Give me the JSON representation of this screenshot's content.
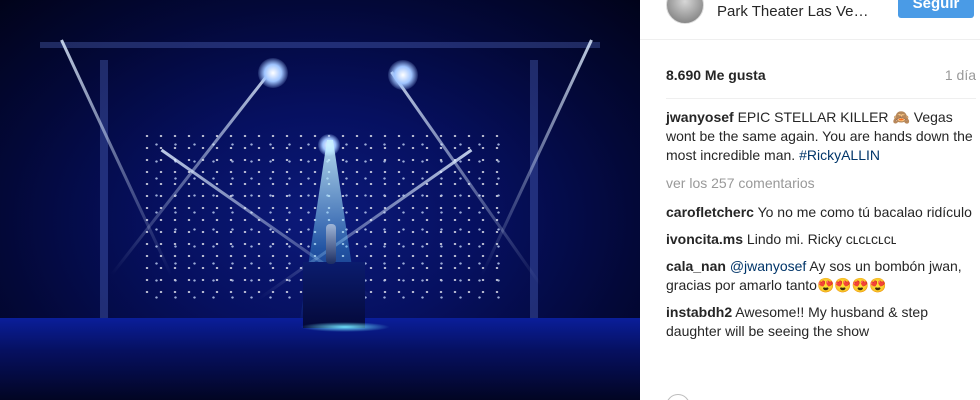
{
  "post": {
    "location": "Park Theater Las Ve…",
    "follow_label": "Seguir",
    "likes": "8.690 Me gusta",
    "time": "1 día"
  },
  "caption": {
    "user": "jwanyosef",
    "line1": "EPIC STELLAR KILLER",
    "emoji": "🙈",
    "text": "Vegas wont be the same again. You are hands down the most incredible man.",
    "hashtag": "#RickyALLIN"
  },
  "view_all": "ver los 257 comentarios",
  "comments": [
    {
      "user": "carofletcherc",
      "text": "Yo no me como tú bacalao ridículo"
    },
    {
      "user": "ivoncita.ms",
      "text": "Lindo mi. Ricky ᴄʟᴄʟᴄʟᴄʟ"
    },
    {
      "user": "cala_nan",
      "mention": "@jwanyosef",
      "text": "Ay sos un bombón jwan, gracias por amarlo tanto",
      "emoji": "😍😍😍😍"
    },
    {
      "user": "instabdh2",
      "text": "Awesome!! My husband & step daughter will be seeing the show"
    }
  ],
  "colors": {
    "follow_button": "#4a9be6",
    "hashtag": "#003569",
    "muted": "#999999",
    "text": "#262626"
  },
  "icons": {
    "avatar": "profile-avatar",
    "bottom": "circle-icon"
  }
}
